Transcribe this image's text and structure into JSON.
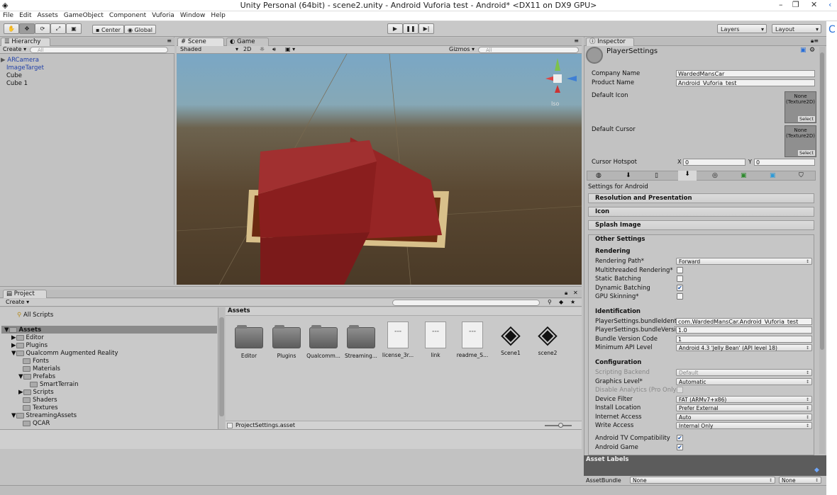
{
  "window": {
    "title": "Unity Personal (64bit) - scene2.unity - Android Vuforia test - Android* <DX11 on DX9 GPU>"
  },
  "menu": [
    "File",
    "Edit",
    "Assets",
    "GameObject",
    "Component",
    "Vuforia",
    "Window",
    "Help"
  ],
  "toolbar": {
    "center_label": "Center",
    "global_label": "Global",
    "layers_label": "Layers",
    "layout_label": "Layout"
  },
  "hierarchy": {
    "tab": "Hierarchy",
    "create": "Create",
    "search_placeholder": "All",
    "items": [
      "ARCamera",
      "ImageTarget",
      "Cube",
      "Cube 1"
    ]
  },
  "scene": {
    "tab_scene": "Scene",
    "tab_game": "Game",
    "shading": "Shaded",
    "mode_2d": "2D",
    "gizmos": "Gizmos",
    "search_placeholder": "All",
    "iso_label": "Iso"
  },
  "project": {
    "tab": "Project",
    "create": "Create",
    "all_scripts": "All Scripts",
    "assets_header": "Assets",
    "footer_file": "ProjectSettings.asset",
    "tree": [
      "Assets",
      "Editor",
      "Plugins",
      "Qualcomm Augmented Reality",
      "Fonts",
      "Materials",
      "Prefabs",
      "SmartTerrain",
      "Scripts",
      "Shaders",
      "Textures",
      "StreamingAssets",
      "QCAR"
    ],
    "assets": [
      {
        "name": "Editor",
        "kind": "folder"
      },
      {
        "name": "Plugins",
        "kind": "folder"
      },
      {
        "name": "Qualcomm...",
        "kind": "folder"
      },
      {
        "name": "Streaming...",
        "kind": "folder"
      },
      {
        "name": "license_3r...",
        "kind": "doc"
      },
      {
        "name": "link",
        "kind": "doc"
      },
      {
        "name": "readme_S...",
        "kind": "doc"
      },
      {
        "name": "Scene1",
        "kind": "unity"
      },
      {
        "name": "scene2",
        "kind": "unity"
      }
    ]
  },
  "inspector": {
    "tab": "Inspector",
    "title": "PlayerSettings",
    "company_label": "Company Name",
    "company_value": "WardedMansCar",
    "product_label": "Product Name",
    "product_value": "Android_Vuforia_test",
    "default_icon": "Default Icon",
    "default_cursor": "Default Cursor",
    "texture_none": "None (Texture2D)",
    "select": "Select",
    "hotspot_label": "Cursor Hotspot",
    "hotspot_x": "0",
    "hotspot_y": "0",
    "settings_for": "Settings for Android",
    "sections": [
      "Resolution and Presentation",
      "Icon",
      "Splash Image"
    ],
    "other": "Other Settings",
    "rendering": "Rendering",
    "rendering_path_label": "Rendering Path*",
    "rendering_path": "Forward",
    "multithreaded": "Multithreaded Rendering*",
    "static_batching": "Static Batching",
    "dynamic_batching": "Dynamic Batching",
    "gpu_skinning": "GPU Skinning*",
    "identification": "Identification",
    "bundle_id_label": "PlayerSettings.bundleIdentifier",
    "bundle_id": "com.WardedMansCar.Android_Vuforia_test",
    "bundle_ver_label": "PlayerSettings.bundleVersion",
    "bundle_ver": "1.0",
    "bundle_code_label": "Bundle Version Code",
    "bundle_code": "1",
    "min_api_label": "Minimum API Level",
    "min_api": "Android 4.3 'Jelly Bean' (API level 18)",
    "configuration": "Configuration",
    "scripting_label": "Scripting Backend",
    "scripting": "Default",
    "graphics_label": "Graphics Level*",
    "graphics": "Automatic",
    "disable_analytics": "Disable Analytics (Pro Only)",
    "device_filter_label": "Device Filter",
    "device_filter": "FAT (ARMv7+x86)",
    "install_label": "Install Location",
    "install": "Prefer External",
    "internet_label": "Internet Access",
    "internet": "Auto",
    "write_label": "Write Access",
    "write": "Internal Only",
    "android_tv": "Android TV Compatibility",
    "android_game": "Android Game",
    "asset_labels": "Asset Labels",
    "asset_bundle": "AssetBundle",
    "none": "None"
  },
  "colors": {
    "selection": "#3d6dbf",
    "link_blue": "#1f3fa8",
    "cube_red": "#8e1f1f"
  }
}
